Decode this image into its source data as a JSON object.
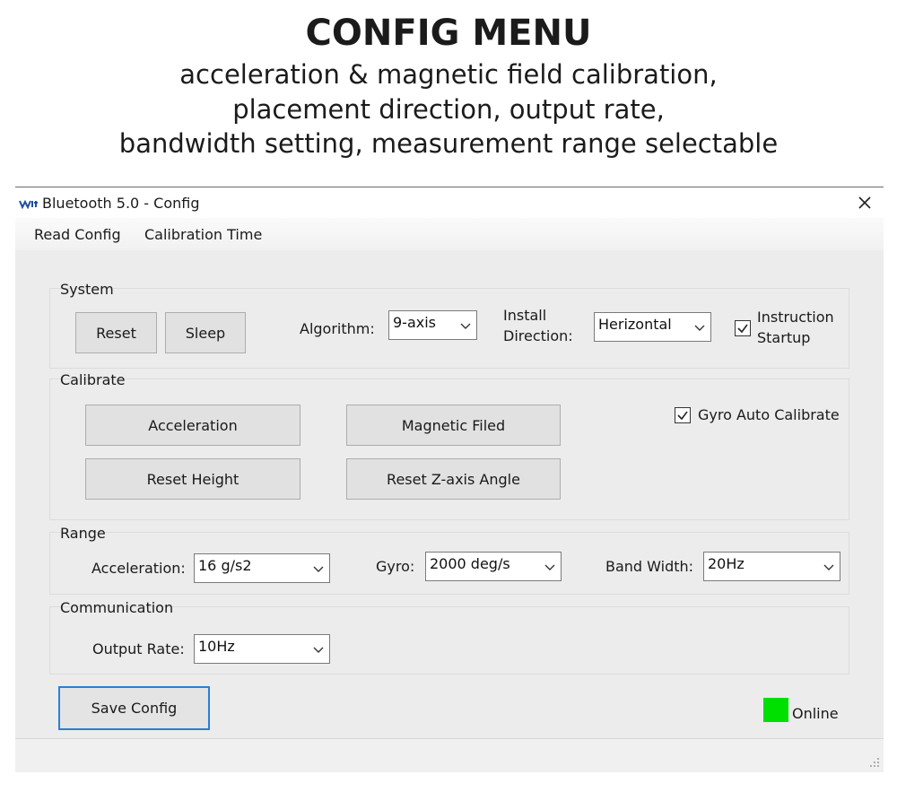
{
  "banner": {
    "title": "CONFIG MENU",
    "line1": "acceleration & magnetic field calibration,",
    "line2": "placement direction, output rate,",
    "line3": "bandwidth setting, measurement range selectable"
  },
  "window": {
    "title": "Bluetooth 5.0 - Config",
    "logo_icon": "wit-logo-icon",
    "close_icon": "close-icon"
  },
  "menu": {
    "read_config": "Read Config",
    "calibration_time": "Calibration Time"
  },
  "system": {
    "label": "System",
    "reset": "Reset",
    "sleep": "Sleep",
    "algorithm_label": "Algorithm:",
    "algorithm_value": "9-axis",
    "install_label_1": "Install",
    "install_label_2": "Direction:",
    "install_value": "Herizontal",
    "instruction_label_1": "Instruction",
    "instruction_label_2": "Startup",
    "instruction_checked": true
  },
  "calibrate": {
    "label": "Calibrate",
    "acceleration": "Acceleration",
    "magnetic": "Magnetic Filed",
    "reset_height": "Reset Height",
    "reset_z": "Reset Z-axis Angle",
    "gyro_auto": "Gyro Auto Calibrate",
    "gyro_auto_checked": true
  },
  "range": {
    "label": "Range",
    "acc_label": "Acceleration:",
    "acc_value": "16 g/s2",
    "gyro_label": "Gyro:",
    "gyro_value": "2000 deg/s",
    "bw_label": "Band Width:",
    "bw_value": "20Hz"
  },
  "communication": {
    "label": "Communication",
    "rate_label": "Output Rate:",
    "rate_value": "10Hz"
  },
  "footer": {
    "save": "Save Config",
    "status": "Online",
    "status_color": "#00e000",
    "accent": "#2b7fd6"
  }
}
